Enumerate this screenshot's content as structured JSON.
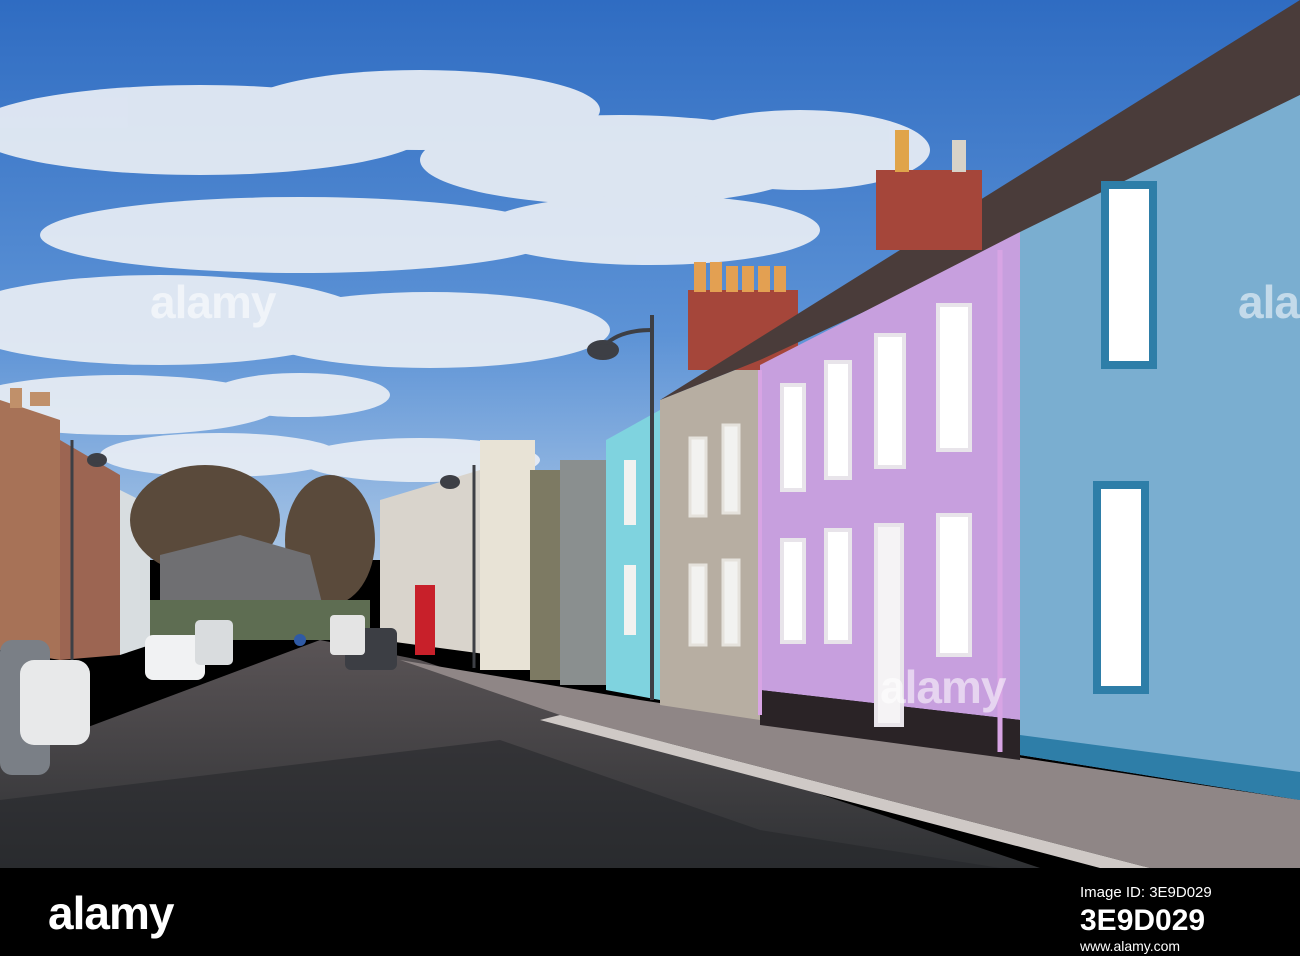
{
  "watermark": {
    "text": "alamy"
  },
  "footer": {
    "brand": "alamy",
    "image_id_label": "Image ID: 3E9D029",
    "image_id": "3E9D029",
    "site_url": "www.alamy.com"
  },
  "colors": {
    "sky": "#3b78c8",
    "lilac_house": "#c79fde",
    "blue_house": "#7aaed0",
    "turquoise_house": "#7fd3df",
    "road": "#3f4146"
  }
}
